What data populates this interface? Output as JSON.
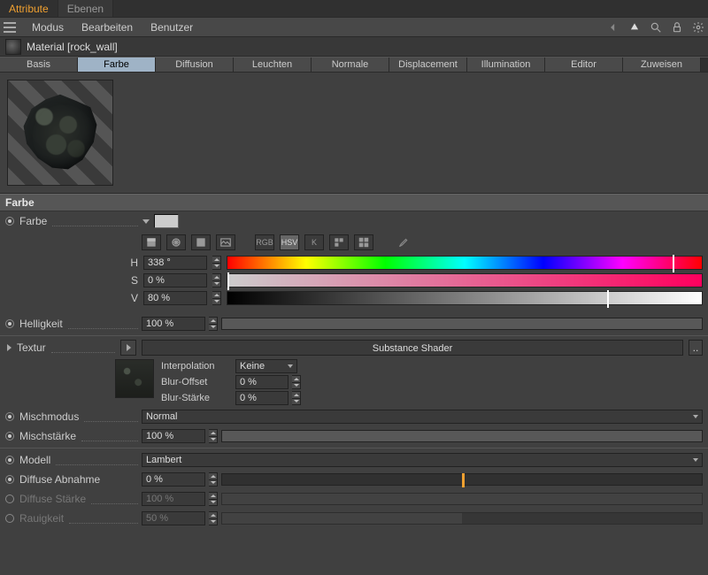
{
  "top_tabs": {
    "attributes": "Attribute",
    "layers": "Ebenen"
  },
  "menu": {
    "mode": "Modus",
    "edit": "Bearbeiten",
    "user": "Benutzer"
  },
  "object": {
    "label": "Material [rock_wall]"
  },
  "sub_tabs": [
    "Basis",
    "Farbe",
    "Diffusion",
    "Leuchten",
    "Normale",
    "Displacement",
    "Illumination",
    "Editor",
    "Zuweisen"
  ],
  "sub_active": 1,
  "section": {
    "color": "Farbe"
  },
  "params": {
    "color": {
      "label": "Farbe"
    },
    "picker_mode": {
      "rgb": "RGB",
      "hsv": "HSV",
      "k": "K"
    },
    "hsv": {
      "h": {
        "label": "H",
        "value": "338 °",
        "pos": 93.8
      },
      "s": {
        "label": "S",
        "value": "0 %",
        "pos": 0
      },
      "v": {
        "label": "V",
        "value": "80 %",
        "pos": 80
      }
    },
    "brightness": {
      "label": "Helligkeit",
      "value": "100 %",
      "pos": 100
    },
    "texture": {
      "label": "Textur",
      "shader": "Substance Shader",
      "interpolation": {
        "label": "Interpolation",
        "value": "Keine"
      },
      "blur_offset": {
        "label": "Blur-Offset",
        "value": "0 %"
      },
      "blur_strength": {
        "label": "Blur-Stärke",
        "value": "0 %"
      }
    },
    "mix_mode": {
      "label": "Mischmodus",
      "value": "Normal"
    },
    "mix_strength": {
      "label": "Mischstärke",
      "value": "100 %",
      "pos": 100
    },
    "model": {
      "label": "Modell",
      "value": "Lambert"
    },
    "diffuse_falloff": {
      "label": "Diffuse Abnahme",
      "value": "0 %",
      "pos": 50
    },
    "diffuse_strength": {
      "label": "Diffuse Stärke",
      "value": "100 %",
      "pos": 100
    },
    "roughness": {
      "label": "Rauigkeit",
      "value": "50 %",
      "pos": 50
    }
  }
}
